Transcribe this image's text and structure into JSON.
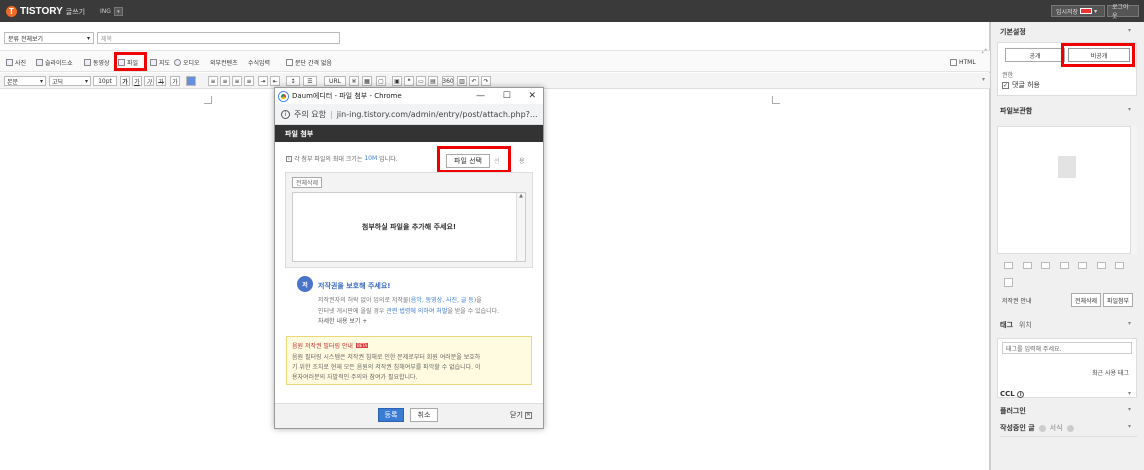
{
  "topbar": {
    "logo": "TISTORY",
    "logo_sub": "글쓰기",
    "blog_name": "ING",
    "temp_save": "임시저장",
    "logout": "로그아웃"
  },
  "editor": {
    "category": "분류 전체보기",
    "title_placeholder": "제목",
    "toolbar": {
      "photo": "사진",
      "slideshow": "슬라이드쇼",
      "video": "동영상",
      "file": "파일",
      "map": "지도",
      "audio": "오디오",
      "external": "외부컨텐츠",
      "formula": "수식입력",
      "paragraph_spacing": "문단 간격 없음",
      "html": "HTML"
    },
    "format": {
      "style": "본문",
      "font": "고딕",
      "size": "10pt",
      "url": "URL"
    }
  },
  "popup": {
    "window_title": "Daum에디터 - 파일 첨부 - Chrome",
    "address_warning": "주의 요함",
    "address_url": "jin-ing.tistory.com/admin/entry/post/attach.php?...",
    "header": "파일 첨부",
    "info": "각 첨부 파일의 최대 크기는",
    "info_size": "10M",
    "info_tail": "입니다.",
    "choose_file": "파일 선택",
    "choose_suffix": "선",
    "right_char": "용",
    "delete_all": "전체삭제",
    "drop_hint": "첨부하실 파일을 추가해 주세요!",
    "copyright_title": "저작권을 보호해 주세요!",
    "copyright_l1a": "저작권자의 허락 없이 임의로 저작물(",
    "copyright_l1b": "음악, 동영상, 사진, 글 등",
    "copyright_l1c": ")을",
    "copyright_l2a": "인터넷 게시판에 올릴 경우",
    "copyright_l2b": "관련 법령에 의하여 처벌",
    "copyright_l2c": "을 받을 수 있습니다.",
    "copyright_more": "자세한 내용 보기 +",
    "music_title": "음원 저작권 필터링 안내",
    "music_badge": "BETA",
    "music_l1": "음원 필터링 시스템은 저작권 침해로 인한 문제로부터 회원 여러분을 보호하",
    "music_l2": "기 위한 조치로 현재 모든 음원의 저작권 침해여부를 파악할 수 없습니다. 이",
    "music_l3": "용자여러분의 자발적인 주의와 참여가 필요합니다.",
    "register": "등록",
    "cancel": "취소",
    "close": "닫기"
  },
  "sidebar": {
    "basic_settings": "기본설정",
    "public": "공개",
    "private": "비공개",
    "permission": "권한",
    "allow_comments": "댓글 허용",
    "file_storage": "파일보관함",
    "copyright_info": "저작권 안내",
    "delete_all": "전체삭제",
    "attach_file": "파일첨부",
    "tag": "태그",
    "location": "위치",
    "tag_placeholder": "태그를 입력해 주세요.",
    "recent_tags": "최근 사용 태그",
    "ccl": "CCL",
    "plugin": "플러그인",
    "writing": "작성중인 글",
    "format": "서식"
  },
  "colors": {
    "accent_red": "#e00000",
    "topbar": "#3a3a3a",
    "primary_blue": "#3b7bd4"
  }
}
